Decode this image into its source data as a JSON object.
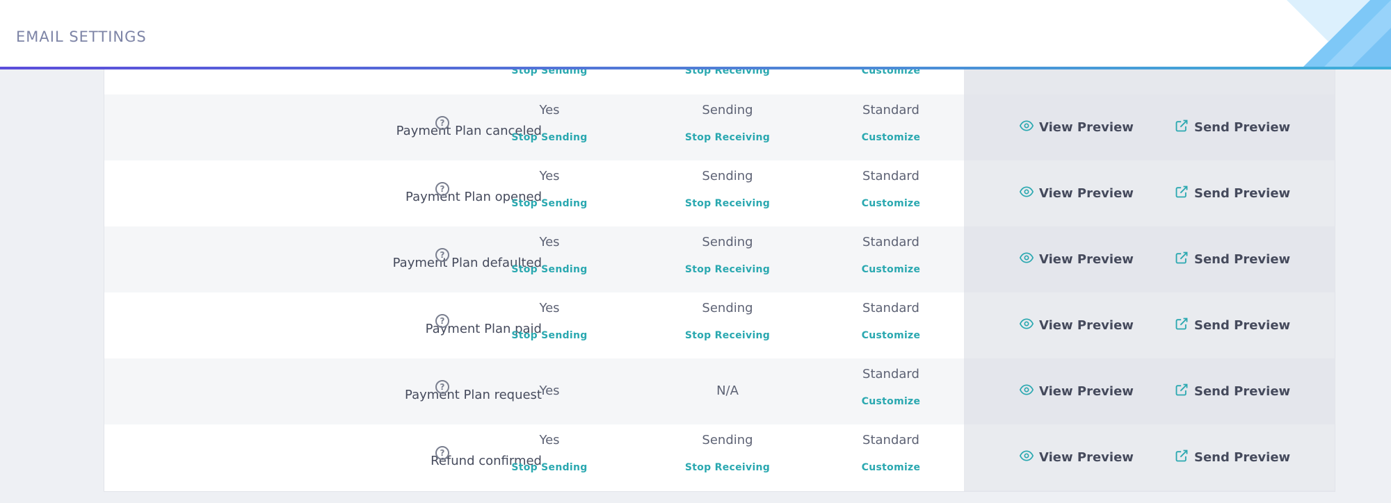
{
  "header": {
    "title": "EMAIL SETTINGS"
  },
  "partial_row": {
    "col1_action": "Stop Sending",
    "col2_action": "Stop Receiving",
    "col3_action": "Customize"
  },
  "rows": [
    {
      "name": "Payment Plan canceled",
      "col1_value": "Yes",
      "col1_action": "Stop Sending",
      "col2_value": "Sending",
      "col2_action": "Stop Receiving",
      "col3_value": "Standard",
      "col3_action": "Customize",
      "view_label": "View Preview",
      "send_label": "Send Preview"
    },
    {
      "name": "Payment Plan opened",
      "col1_value": "Yes",
      "col1_action": "Stop Sending",
      "col2_value": "Sending",
      "col2_action": "Stop Receiving",
      "col3_value": "Standard",
      "col3_action": "Customize",
      "view_label": "View Preview",
      "send_label": "Send Preview"
    },
    {
      "name": "Payment Plan defaulted",
      "col1_value": "Yes",
      "col1_action": "Stop Sending",
      "col2_value": "Sending",
      "col2_action": "Stop Receiving",
      "col3_value": "Standard",
      "col3_action": "Customize",
      "view_label": "View Preview",
      "send_label": "Send Preview"
    },
    {
      "name": "Payment Plan paid",
      "col1_value": "Yes",
      "col1_action": "Stop Sending",
      "col2_value": "Sending",
      "col2_action": "Stop Receiving",
      "col3_value": "Standard",
      "col3_action": "Customize",
      "view_label": "View Preview",
      "send_label": "Send Preview"
    },
    {
      "name": "Payment Plan request",
      "col1_value": "Yes",
      "col1_action": "",
      "col2_value": "N/A",
      "col2_action": "",
      "col3_value": "Standard",
      "col3_action": "Customize",
      "view_label": "View Preview",
      "send_label": "Send Preview"
    },
    {
      "name": "Refund confirmed",
      "col1_value": "Yes",
      "col1_action": "Stop Sending",
      "col2_value": "Sending",
      "col2_action": "Stop Receiving",
      "col3_value": "Standard",
      "col3_action": "Customize",
      "view_label": "View Preview",
      "send_label": "Send Preview"
    }
  ],
  "help_glyph": "?",
  "icons": {
    "view": "eye-icon",
    "send": "external-link-icon",
    "help": "help-circle-icon"
  },
  "colors": {
    "accent": "#2aa8b0",
    "header_title": "#7d84a6",
    "text": "#454a5c"
  }
}
